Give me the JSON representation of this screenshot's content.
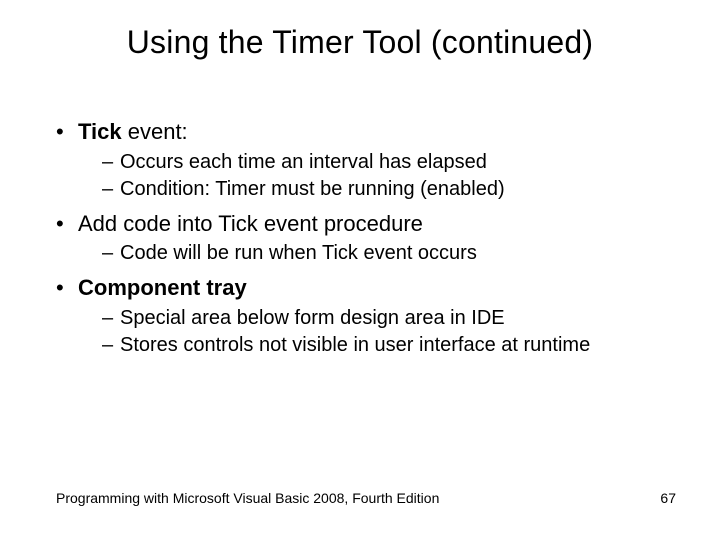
{
  "title": "Using the Timer Tool (continued)",
  "bullets": {
    "b1": {
      "bold": "Tick",
      "rest": " event:"
    },
    "b1s1": "Occurs each time an interval has elapsed",
    "b1s2": "Condition: Timer must be running (enabled)",
    "b2": "Add code into Tick event procedure",
    "b2s1": "Code will be run when Tick event occurs",
    "b3": "Component tray",
    "b3s1": "Special area below form design area in IDE",
    "b3s2": "Stores controls not visible in user interface at runtime"
  },
  "footer": {
    "text": "Programming with Microsoft Visual Basic 2008, Fourth Edition",
    "page": "67"
  }
}
